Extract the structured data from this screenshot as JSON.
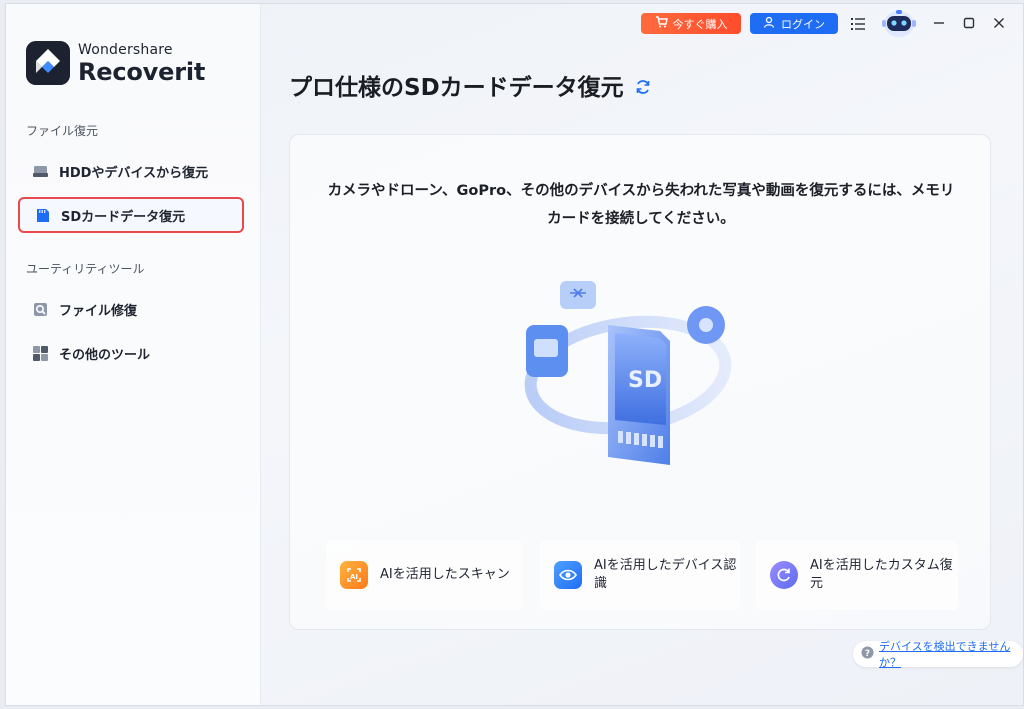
{
  "app": {
    "brand": "Wondershare",
    "product": "Recoverit"
  },
  "topbar": {
    "buy_label": "今すぐ購入",
    "login_label": "ログイン"
  },
  "sidebar": {
    "section1_label": "ファイル復元",
    "items1": [
      {
        "label": "HDDやデバイスから復元",
        "icon": "hdd-icon"
      },
      {
        "label": "SDカードデータ復元",
        "icon": "sd-card-icon"
      }
    ],
    "section2_label": "ユーティリティツール",
    "items2": [
      {
        "label": "ファイル修復",
        "icon": "file-repair-icon"
      },
      {
        "label": "その他のツール",
        "icon": "more-tools-icon"
      }
    ]
  },
  "main": {
    "title": "プロ仕様のSDカードデータ復元",
    "instruction_line1": "カメラやドローン、GoPro、その他のデバイスから失われた写真や動画を復元するには、メモリ",
    "instruction_line2": "カードを接続してください。",
    "illustration_text": "SD",
    "features": [
      {
        "line1": "AIを活用したスキャン",
        "line2": ""
      },
      {
        "line1": "AIを活用したデバイス認",
        "line2": "識"
      },
      {
        "line1": "AIを活用したカスタム復",
        "line2": "元"
      }
    ],
    "help_link": "デバイスを検出できませんか？"
  },
  "colors": {
    "accent": "#1f6df5",
    "buy": "#ff5533",
    "active_border": "#e8494b"
  }
}
